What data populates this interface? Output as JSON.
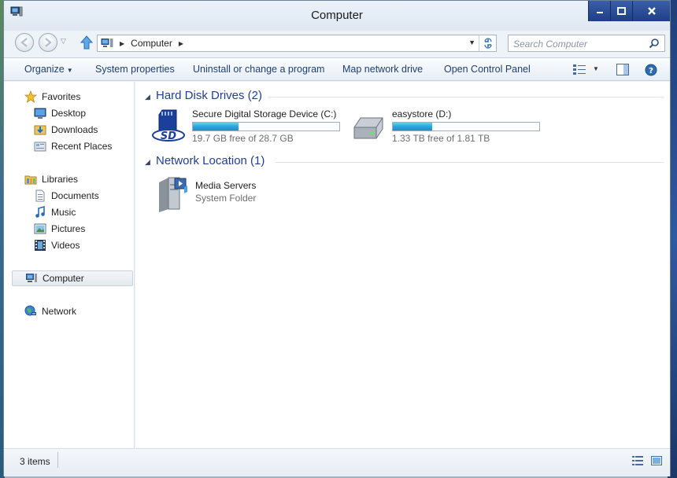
{
  "window": {
    "title": "Computer"
  },
  "address": {
    "crumb": "Computer",
    "search_placeholder": "Search Computer"
  },
  "toolbar": {
    "organize": "Organize",
    "system_properties": "System properties",
    "uninstall": "Uninstall or change a program",
    "map_drive": "Map network drive",
    "open_control_panel": "Open Control Panel"
  },
  "nav": {
    "favorites": "Favorites",
    "desktop": "Desktop",
    "downloads": "Downloads",
    "recent": "Recent Places",
    "libraries": "Libraries",
    "documents": "Documents",
    "music": "Music",
    "pictures": "Pictures",
    "videos": "Videos",
    "computer": "Computer",
    "network": "Network"
  },
  "groups": {
    "hdd": "Hard Disk Drives (2)",
    "netloc": "Network Location (1)"
  },
  "drives": [
    {
      "name": "Secure Digital Storage Device (C:)",
      "free": "19.7 GB free of 28.7 GB",
      "used_fraction": 0.31
    },
    {
      "name": "easystore (D:)",
      "free": "1.33 TB free of 1.81 TB",
      "used_fraction": 0.27
    }
  ],
  "network_items": [
    {
      "name": "Media Servers",
      "type": "System Folder"
    }
  ],
  "status": {
    "count": "3 items"
  },
  "colors": {
    "accent": "#1e3f8f",
    "bar_fill": "#26a7d8"
  }
}
